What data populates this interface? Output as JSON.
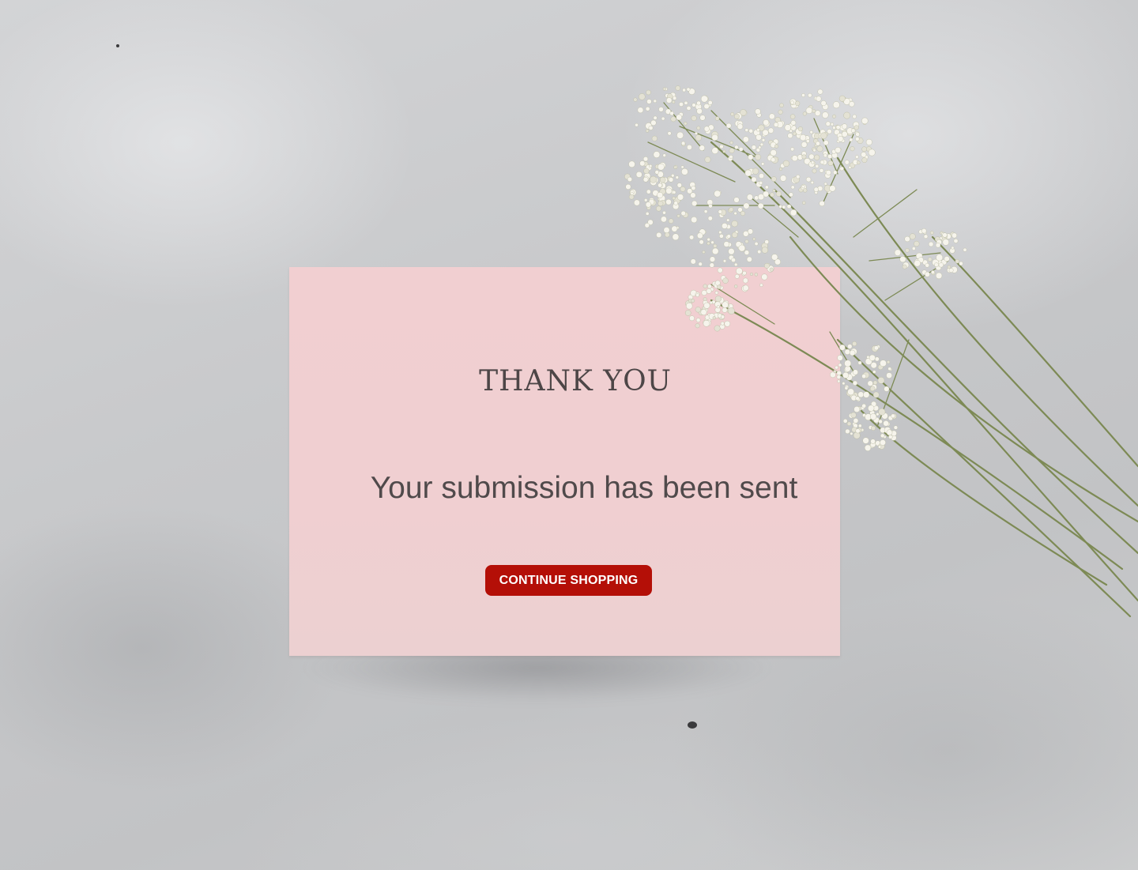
{
  "card": {
    "title": "THANK YOU",
    "message": "Your submission has been sent",
    "button_label": "CONTINUE SHOPPING"
  },
  "colors": {
    "card_background": "#f0cfd1",
    "button_background": "#b40f07",
    "button_text": "#ffffff",
    "text": "#4d4647",
    "backdrop": "#c9cacc"
  },
  "decoration": {
    "flower": "gypsophila-bouquet"
  }
}
